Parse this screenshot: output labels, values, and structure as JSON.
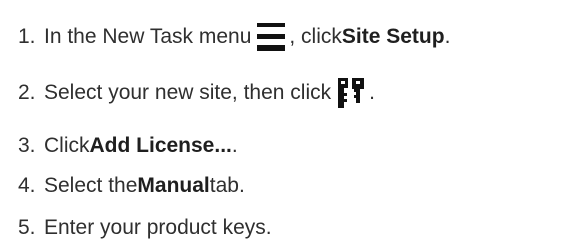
{
  "steps": [
    {
      "number": "1.",
      "text_before": "In the New Task menu",
      "icon": "hamburger-menu-icon",
      "text_middle": ", click ",
      "bold": "Site Setup",
      "text_after": "."
    },
    {
      "number": "2.",
      "text_before": "Select your new site, then click",
      "icon": "keys-icon",
      "text_after": "."
    },
    {
      "number": "3.",
      "text_before": "Click ",
      "bold": "Add License...",
      "text_after": "."
    },
    {
      "number": "4.",
      "text_before": "Select the ",
      "bold": "Manual",
      "text_after": " tab."
    },
    {
      "number": "5.",
      "text_before": "Enter your product keys."
    }
  ],
  "colors": {
    "text": "#2f2f2f",
    "icon": "#111111"
  }
}
